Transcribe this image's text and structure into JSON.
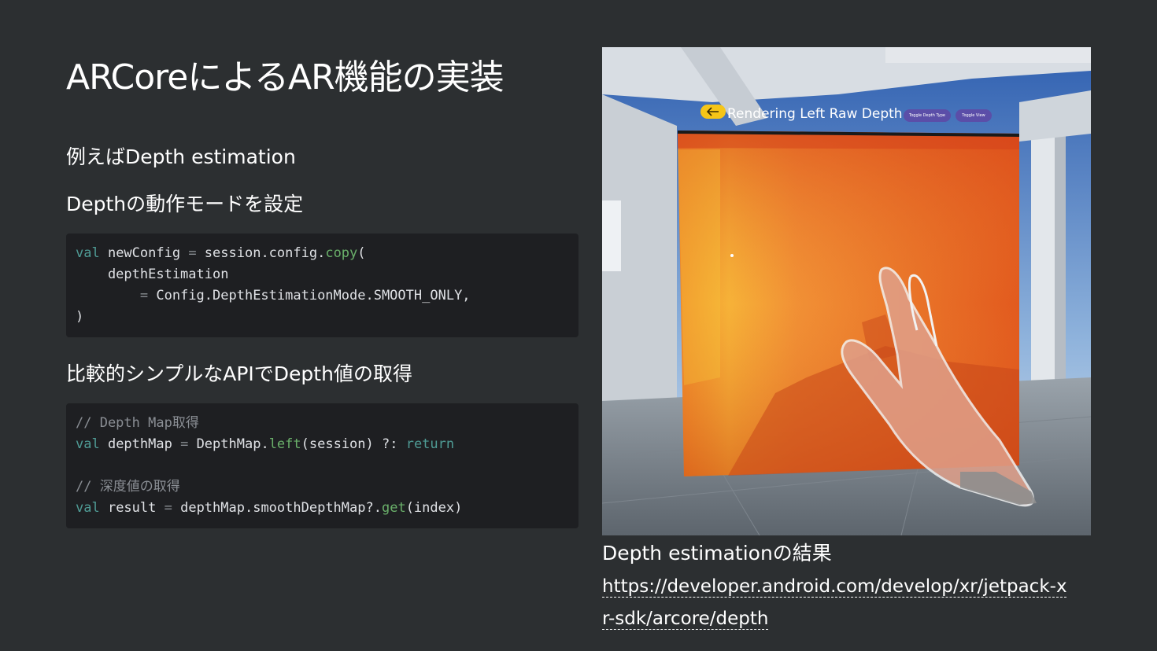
{
  "slide": {
    "title": "ARCoreによるAR機能の実装",
    "subtitle1": "例えばDepth estimation",
    "subtitle2": "Depthの動作モードを設定",
    "subtitle3": "比較的シンプルなAPIでDepth値の取得"
  },
  "code1": {
    "l1_kw": "val",
    "l1_var": " newConfig ",
    "l1_op": "=",
    "l1_expr": " session.config.",
    "l1_fn": "copy",
    "l1_paren": "(",
    "l2": "    depthEstimation",
    "l3_indent": "        ",
    "l3_op": "=",
    "l3_expr": " Config.DepthEstimationMode.SMOOTH_ONLY,",
    "l4": ")"
  },
  "code2": {
    "l1_comment": "// Depth Map取得",
    "l2_kw": "val",
    "l2_var": " depthMap ",
    "l2_op": "=",
    "l2_expr": " DepthMap.",
    "l2_fn": "left",
    "l2_args": "(session) ?: ",
    "l2_ret": "return",
    "l4_comment": "// 深度値の取得",
    "l5_kw": "val",
    "l5_var": " result ",
    "l5_op": "=",
    "l5_expr": " depthMap.smoothDepthMap?.",
    "l5_fn": "get",
    "l5_args": "(index)"
  },
  "screenshot": {
    "panel_title": "Rendering Left Raw Depth",
    "toggle_depth_type": "Toggle Depth Type",
    "toggle_view": "Toggle View",
    "back_icon": "arrow-left-icon"
  },
  "caption": {
    "text": "Depth estimationの結果",
    "link": "https://developer.android.com/develop/xr/jetpack-xr-sdk/arcore/depth"
  }
}
